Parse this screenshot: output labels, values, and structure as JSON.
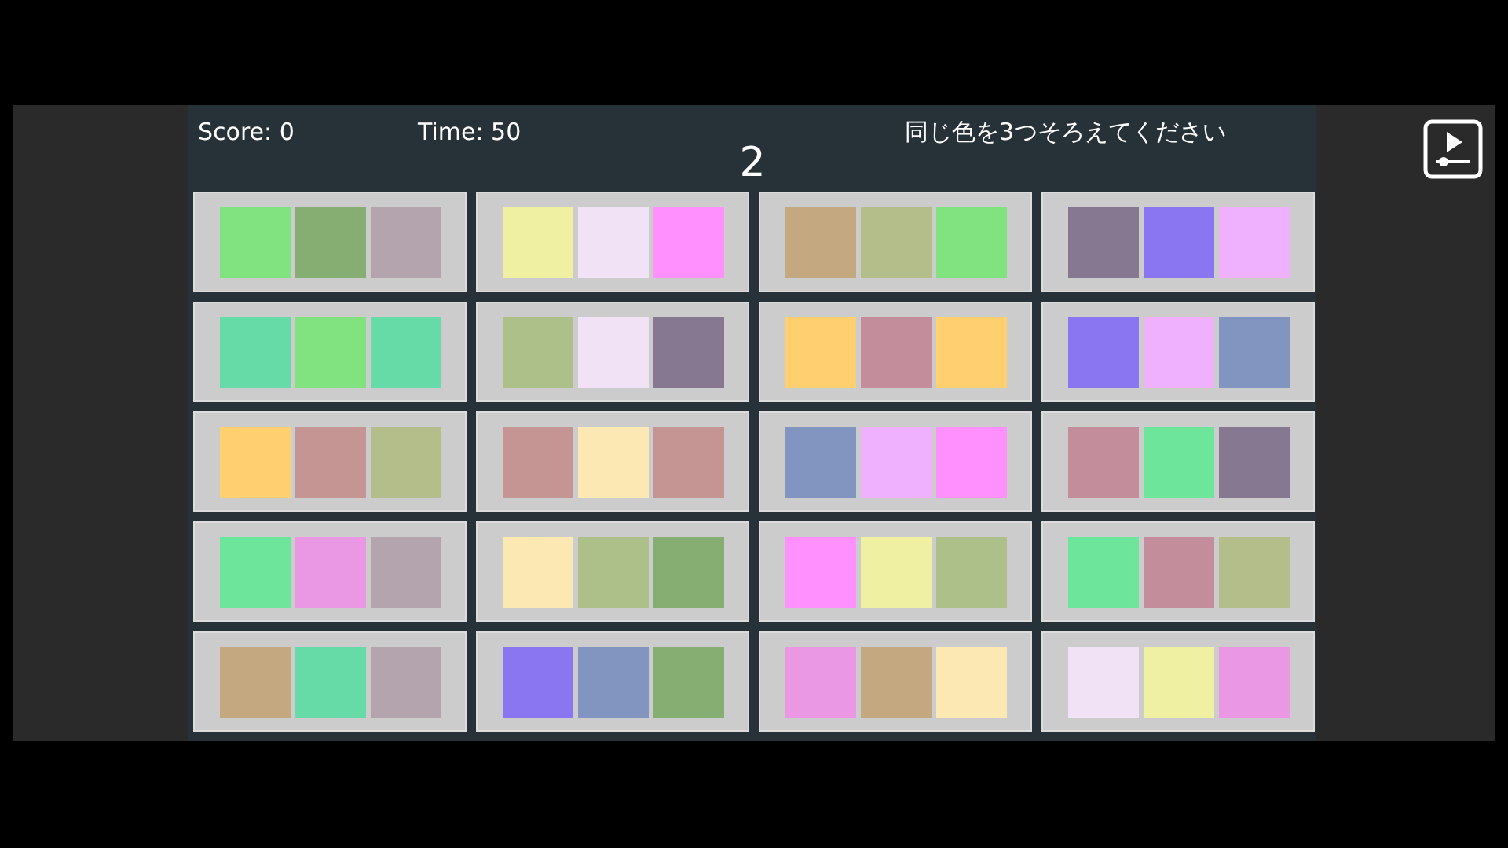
{
  "header": {
    "score": "Score: 0",
    "time": "Time: 50",
    "instruction": "同じ色を3つそろえてください",
    "count": "2"
  },
  "tiles": [
    {
      "swatches": [
        {
          "color": "#80e380"
        },
        {
          "color": "#86ad72"
        },
        {
          "color": "#b4a4ae"
        }
      ]
    },
    {
      "swatches": [
        {
          "color": "#f0f0a2"
        },
        {
          "color": "#f1e2f6"
        },
        {
          "color": "#ff90fd"
        }
      ]
    },
    {
      "swatches": [
        {
          "color": "#c4a880"
        },
        {
          "color": "#b4be8a"
        },
        {
          "color": "#80e380"
        }
      ]
    },
    {
      "swatches": [
        {
          "color": "#877891"
        },
        {
          "color": "#8b76f2"
        },
        {
          "color": "#efb0fd"
        }
      ]
    },
    {
      "swatches": [
        {
          "color": "#66dba8"
        },
        {
          "color": "#80e380"
        },
        {
          "color": "#66dba8"
        }
      ]
    },
    {
      "swatches": [
        {
          "color": "#adc089"
        },
        {
          "color": "#f1e2f6"
        },
        {
          "color": "#877891"
        }
      ]
    },
    {
      "swatches": [
        {
          "color": "#ffcf70"
        },
        {
          "color": "#c48d9b"
        },
        {
          "color": "#ffcf70"
        }
      ]
    },
    {
      "swatches": [
        {
          "color": "#8b76f2"
        },
        {
          "color": "#efb0fd"
        },
        {
          "color": "#8295c0"
        }
      ]
    },
    {
      "swatches": [
        {
          "color": "#ffcf70"
        },
        {
          "color": "#c49592"
        },
        {
          "color": "#b4be8a"
        }
      ]
    },
    {
      "swatches": [
        {
          "color": "#c49592"
        },
        {
          "color": "#fbe8b2"
        },
        {
          "color": "#c49592"
        }
      ]
    },
    {
      "swatches": [
        {
          "color": "#8295c0"
        },
        {
          "color": "#efb0fd"
        },
        {
          "color": "#ff90fd"
        }
      ]
    },
    {
      "swatches": [
        {
          "color": "#c48d9b"
        },
        {
          "color": "#6de59b"
        },
        {
          "color": "#877891"
        }
      ]
    },
    {
      "swatches": [
        {
          "color": "#6de59b"
        },
        {
          "color": "#ea98e4"
        },
        {
          "color": "#b4a4ae"
        }
      ]
    },
    {
      "swatches": [
        {
          "color": "#fbe8b2"
        },
        {
          "color": "#adc089"
        },
        {
          "color": "#86ad72"
        }
      ]
    },
    {
      "swatches": [
        {
          "color": "#ff90fd"
        },
        {
          "color": "#f0f0a2"
        },
        {
          "color": "#adc089"
        }
      ]
    },
    {
      "swatches": [
        {
          "color": "#6de59b"
        },
        {
          "color": "#c48d9b"
        },
        {
          "color": "#b4be8a"
        }
      ]
    },
    {
      "swatches": [
        {
          "color": "#c4a880"
        },
        {
          "color": "#66dba8"
        },
        {
          "color": "#b4a4ae"
        }
      ]
    },
    {
      "swatches": [
        {
          "color": "#8b76f2"
        },
        {
          "color": "#8295c0"
        },
        {
          "color": "#86ad72"
        }
      ]
    },
    {
      "swatches": [
        {
          "color": "#ea98e4"
        },
        {
          "color": "#c4a880"
        },
        {
          "color": "#fbe8b2"
        }
      ]
    },
    {
      "swatches": [
        {
          "color": "#f1e2f6"
        },
        {
          "color": "#f0f0a2"
        },
        {
          "color": "#ea98e4"
        }
      ]
    }
  ]
}
